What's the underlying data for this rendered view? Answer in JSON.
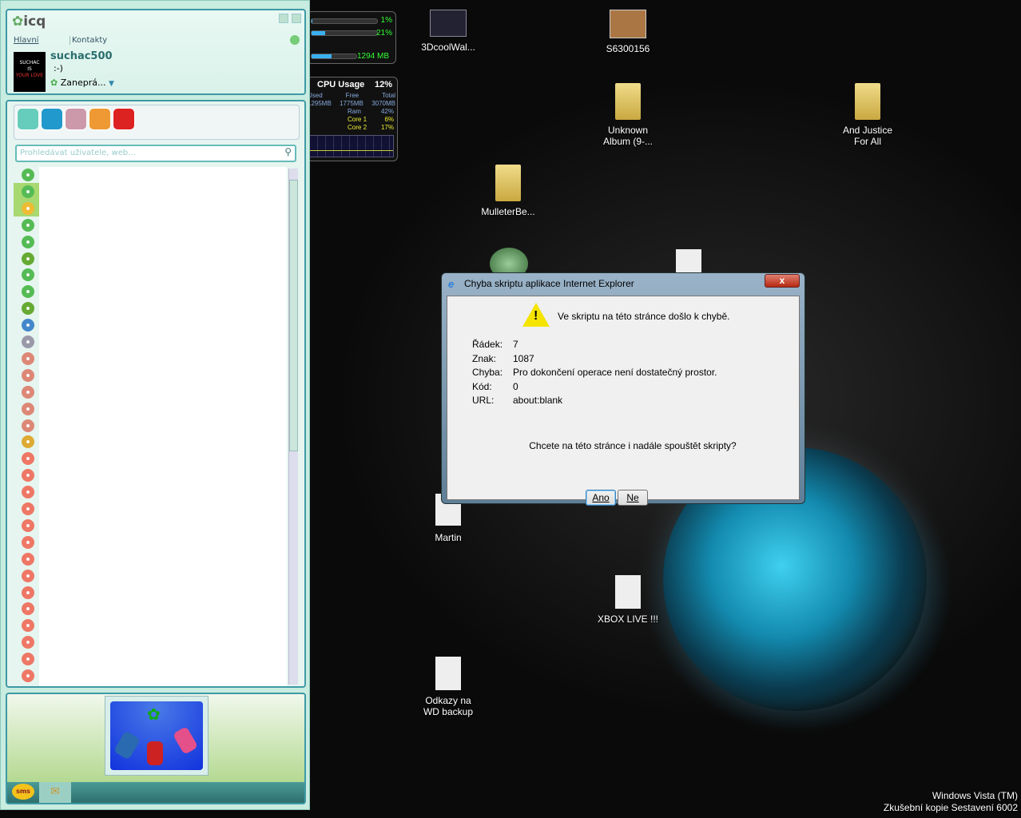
{
  "icq": {
    "logo": "icq",
    "tabs": [
      "Hlavní",
      "Kontakty"
    ],
    "username": "suchac500",
    "mood": ":-)",
    "status": "Zaneprá...",
    "avatar_text": [
      "SUCHAC",
      "IS",
      "YOUR LOVE"
    ],
    "search_placeholder": "Prohledávat uživatele, web...",
    "toolbar_icons": [
      "gamepad-icon",
      "tv-icon",
      "avatar-game-icon",
      "equalizer-icon",
      "heart-question-icon"
    ],
    "contacts": [
      "online",
      "online-selected",
      "auth-lock",
      "online",
      "online",
      "custom-face",
      "online",
      "online",
      "custom-face",
      "mail",
      "gray-multi",
      "offline-gift",
      "offline-gift",
      "offline-gift",
      "offline-gift",
      "offline-gift",
      "transfer",
      "offline",
      "offline",
      "offline",
      "offline",
      "offline",
      "offline",
      "offline",
      "offline",
      "offline",
      "offline",
      "offline",
      "offline",
      "offline",
      "offline"
    ],
    "bottom_tabs": [
      "sms",
      "mail-icon"
    ],
    "banner": "icq-mobile-banner"
  },
  "gadgets": {
    "cpu_meter": {
      "values": [
        "1%",
        "21%"
      ],
      "mem": "1294 MB",
      "fill": [
        0.01,
        0.21,
        0.45
      ]
    },
    "cpu_usage": {
      "title": "CPU Usage",
      "total": "12%",
      "headers": [
        "Used",
        "Free",
        "Total"
      ],
      "values": [
        "1295MB",
        "1775MB",
        "3070MB"
      ],
      "rows": [
        {
          "label": "Ram",
          "value": "42%"
        },
        {
          "label": "Core 1",
          "value": "6%"
        },
        {
          "label": "Core 2",
          "value": "17%"
        }
      ]
    }
  },
  "desktop": {
    "icons": [
      {
        "label": "3DcoolWal..."
      },
      {
        "label": "S6300156"
      },
      {
        "label": "Unknown Album (9-..."
      },
      {
        "label": "And Justice For All"
      },
      {
        "label": "MulleterBe..."
      },
      {
        "label": ""
      },
      {
        "label": ""
      },
      {
        "label": "Martin"
      },
      {
        "label": "XBOX LIVE !!!"
      },
      {
        "label": "Odkazy na WD backup"
      }
    ],
    "watermark": [
      "Windows Vista (TM)",
      "Zkušební kopie Sestavení 6002"
    ]
  },
  "dialog": {
    "title": "Chyba skriptu aplikace Internet Explorer",
    "message": "Ve skriptu na této stránce došlo k chybě.",
    "fields": [
      {
        "label": "Řádek:",
        "value": "7"
      },
      {
        "label": "Znak:",
        "value": "1087"
      },
      {
        "label": "Chyba:",
        "value": "Pro dokončení operace není dostatečný prostor."
      },
      {
        "label": "Kód:",
        "value": "0"
      },
      {
        "label": "URL:",
        "value": "about:blank"
      }
    ],
    "question": "Chcete na této stránce i nadále spouštět skripty?",
    "yes": "Ano",
    "no": "Ne",
    "close": "x"
  }
}
